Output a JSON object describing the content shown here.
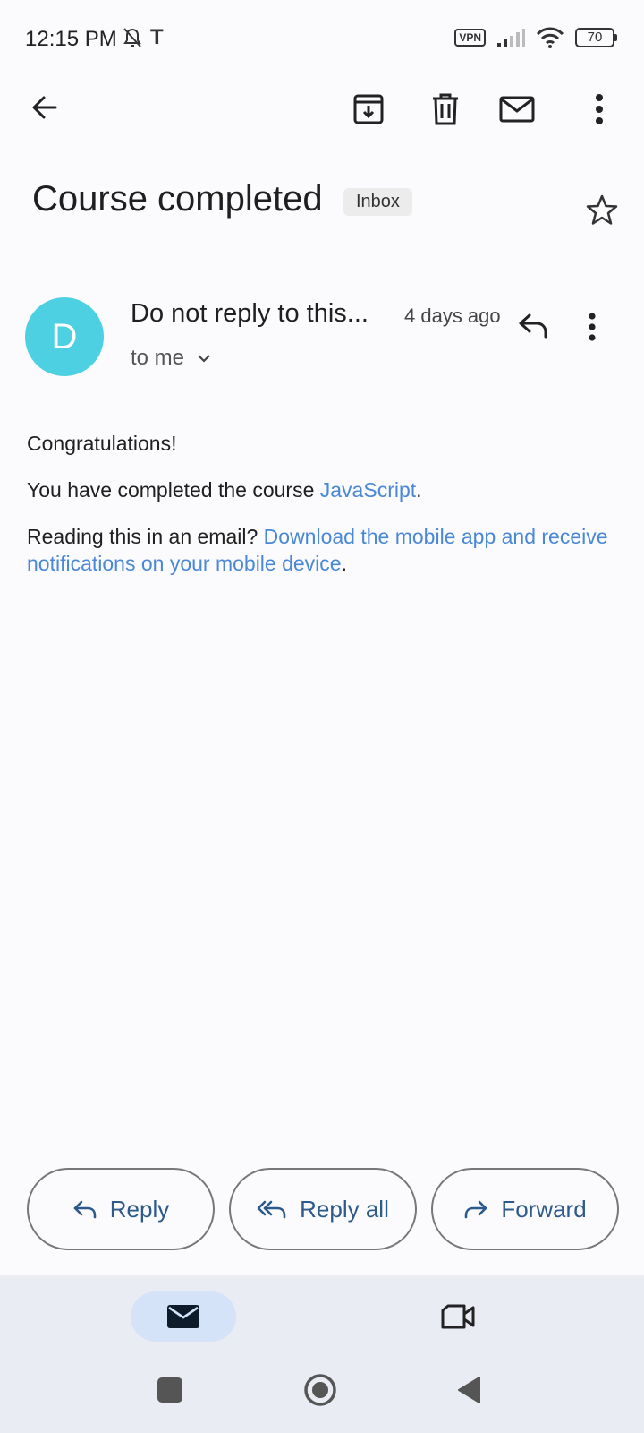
{
  "status_bar": {
    "time": "12:15 PM",
    "carrier_icon": "T",
    "vpn": "VPN",
    "battery": "70"
  },
  "toolbar": {
    "icons": [
      "back-arrow-icon",
      "archive-icon",
      "trash-icon",
      "mail-icon",
      "more-vert-icon"
    ]
  },
  "email": {
    "subject": "Course completed",
    "label": "Inbox",
    "sender_initial": "D",
    "sender_name": "Do not reply to this...",
    "time_ago": "4 days ago",
    "recipient": "to me",
    "body": {
      "greeting": "Congratulations!",
      "line1_prefix": "You have completed the course ",
      "line1_link": "JavaScript",
      "line1_suffix": ".",
      "line2_prefix": "Reading this in an email? ",
      "line2_link": "Download the mobile app and receive notifications on your mobile device",
      "line2_suffix": "."
    }
  },
  "actions": {
    "reply": "Reply",
    "reply_all": "Reply all",
    "forward": "Forward"
  },
  "colors": {
    "avatar": "#4dd0e1",
    "link": "#4a88d6",
    "action_text": "#2d5a8a",
    "nav_active": "#d4e3f8"
  }
}
